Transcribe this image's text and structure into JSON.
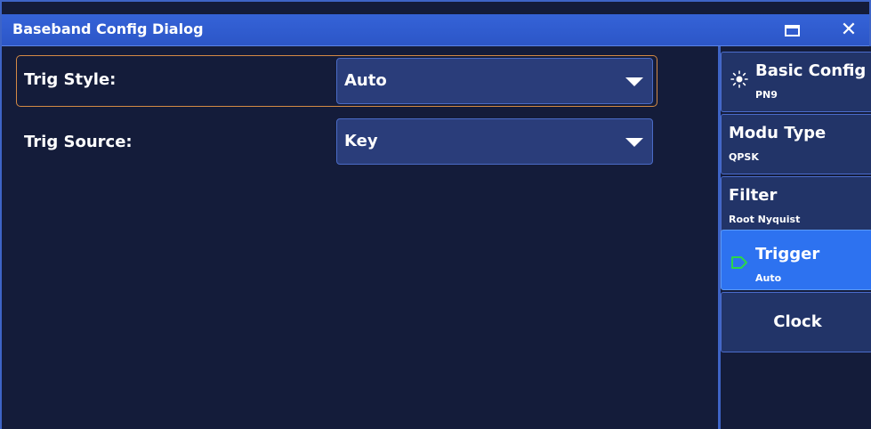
{
  "window": {
    "title": "Baseband Config Dialog"
  },
  "form": {
    "rows": [
      {
        "label": "Trig Style:",
        "value": "Auto"
      },
      {
        "label": "Trig Source:",
        "value": "Key"
      }
    ]
  },
  "sidebar": {
    "items": [
      {
        "label": "Basic Config",
        "sub": "PN9",
        "icon": "sun-icon"
      },
      {
        "label": "Modu Type",
        "sub": "QPSK"
      },
      {
        "label": "Filter",
        "sub": "Root Nyquist"
      },
      {
        "label": "Trigger",
        "sub": "Auto",
        "icon": "trigger-tag-icon",
        "active": true
      },
      {
        "label": "Clock"
      }
    ]
  },
  "colors": {
    "titlebar": "#2c56c7",
    "background": "#141c3a",
    "selected_border": "#d48a45",
    "active_button": "#2d72f0",
    "trigger_icon": "#2bd64b"
  }
}
